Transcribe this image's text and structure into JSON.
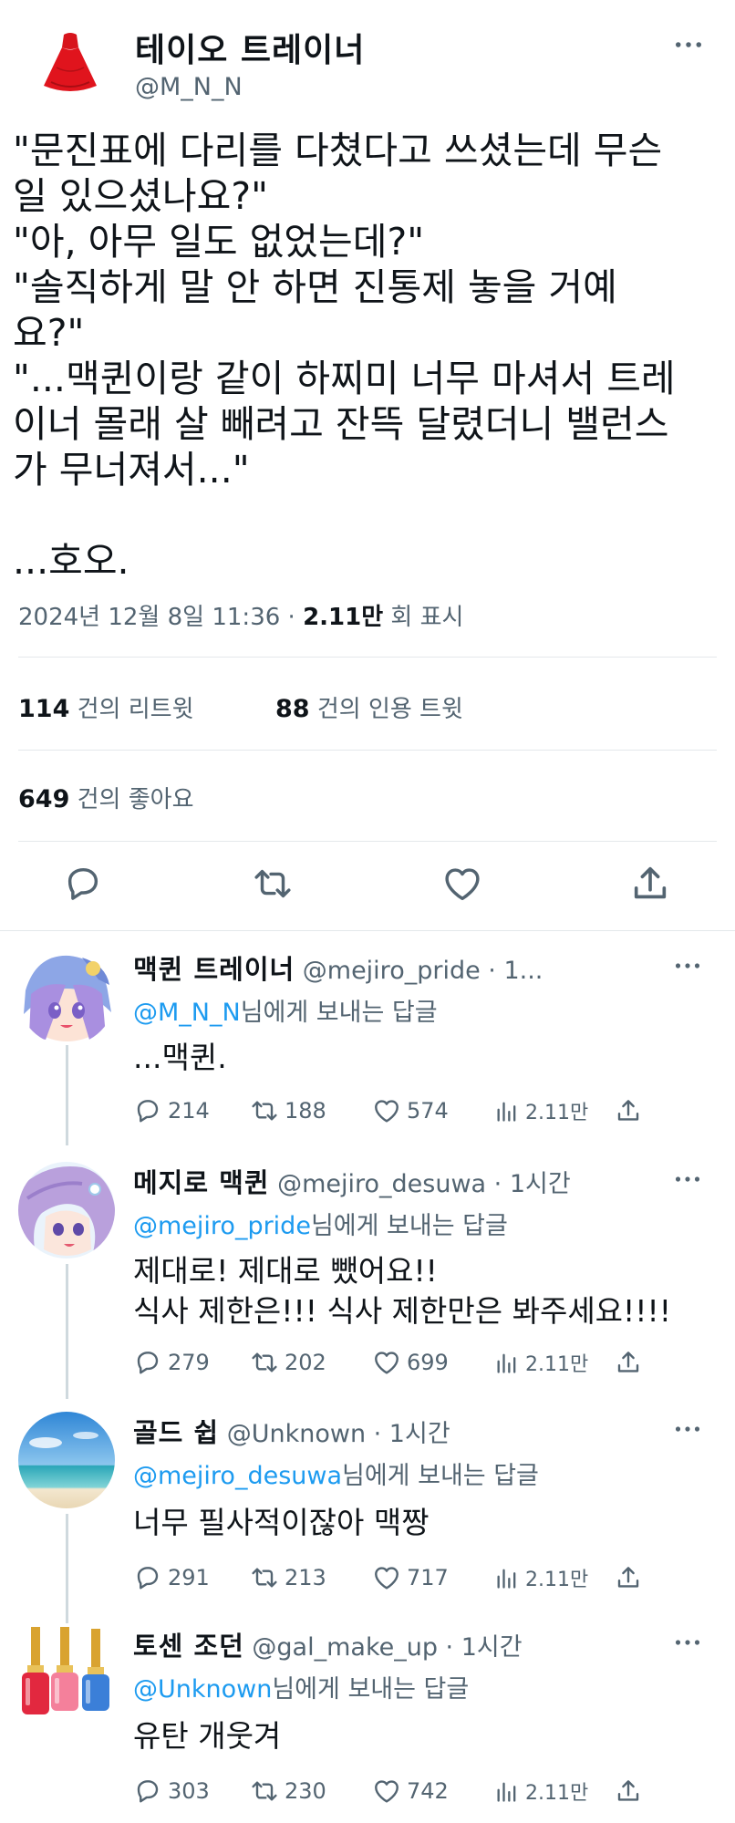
{
  "main_tweet": {
    "display_name": "테이오 트레이너",
    "handle": "@M_N_N",
    "avatar_icon": "red-dress-icon",
    "text": "\"문진표에 다리를 다쳤다고 쓰셨는데 무슨\n일 있으셨나요?\"\n\"아, 아무 일도 없었는데?\"\n\"솔직하게 말 안 하면 진통제 놓을 거예\n요?\"\n\"...맥퀸이랑 같이 하찌미 너무 마셔서 트레\n이너 몰래 살 빼려고 잔뜩 달렸더니 밸런스\n가 무너져서...\"\n\n...호오.",
    "timestamp": "2024년 12월 8일  11:36 · ",
    "views_value": "2.11만",
    "views_label": " 회 표시",
    "retweets_value": "114",
    "retweets_label": " 건의 리트윗",
    "quotes_value": "88",
    "quotes_label": " 건의 인용 트윗",
    "likes_value": "649",
    "likes_label": " 건의 좋아요"
  },
  "replies": [
    {
      "display_name": "맥퀸 트레이너",
      "handle": " @mejiro_pride · 1...",
      "mention": "@M_N_N",
      "reply_suffix": "님에게 보내는 답글",
      "text": "...맥퀸.",
      "replies": "214",
      "retweets": "188",
      "likes": "574",
      "views": "2.11만"
    },
    {
      "display_name": "메지로 맥퀸",
      "handle": " @mejiro_desuwa · 1시간",
      "mention": "@mejiro_pride",
      "reply_suffix": "님에게 보내는 답글",
      "text": "제대로! 제대로 뺐어요!!\n식사 제한은!!! 식사 제한만은 봐주세요!!!!",
      "replies": "279",
      "retweets": "202",
      "likes": "699",
      "views": "2.11만"
    },
    {
      "display_name": "골드 쉽",
      "handle": " @Unknown · 1시간",
      "mention": "@mejiro_desuwa",
      "reply_suffix": "님에게 보내는 답글",
      "text": "너무 필사적이잖아 맥짱",
      "replies": "291",
      "retweets": "213",
      "likes": "717",
      "views": "2.11만"
    },
    {
      "display_name": "토센 조던",
      "handle": " @gal_make_up · 1시간",
      "mention": "@Unknown",
      "reply_suffix": "님에게 보내는 답글",
      "text": "유탄 개웃겨",
      "replies": "303",
      "retweets": "230",
      "likes": "742",
      "views": "2.11만"
    }
  ],
  "colors": {
    "text": "#0f1419",
    "secondary": "#536471",
    "link": "#1d9bf0",
    "divider": "#e4e8eb",
    "thread_line": "#cfd9de"
  }
}
